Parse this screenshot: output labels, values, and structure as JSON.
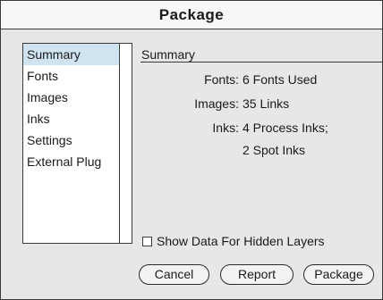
{
  "window": {
    "title": "Package"
  },
  "sidebar": {
    "items": [
      {
        "label": "Summary",
        "selected": true
      },
      {
        "label": "Fonts",
        "selected": false
      },
      {
        "label": "Images",
        "selected": false
      },
      {
        "label": "Inks",
        "selected": false
      },
      {
        "label": "Settings",
        "selected": false
      },
      {
        "label": "External Plug",
        "selected": false
      }
    ]
  },
  "summary": {
    "heading": "Summary",
    "fonts_label": "Fonts:",
    "fonts_value": "6 Fonts Used",
    "images_label": "Images:",
    "images_value": "35 Links",
    "inks_label": "Inks:",
    "inks_value_line1": "4 Process Inks;",
    "inks_value_line2": "2 Spot Inks"
  },
  "options": {
    "show_hidden_layers_label": "Show Data For Hidden Layers",
    "show_hidden_layers_checked": false
  },
  "buttons": {
    "cancel": "Cancel",
    "report": "Report",
    "package": "Package"
  },
  "colors": {
    "dialog_bg": "#e7e7e7",
    "selection_bg": "#cfe3f1",
    "border": "#3a3a3a"
  }
}
